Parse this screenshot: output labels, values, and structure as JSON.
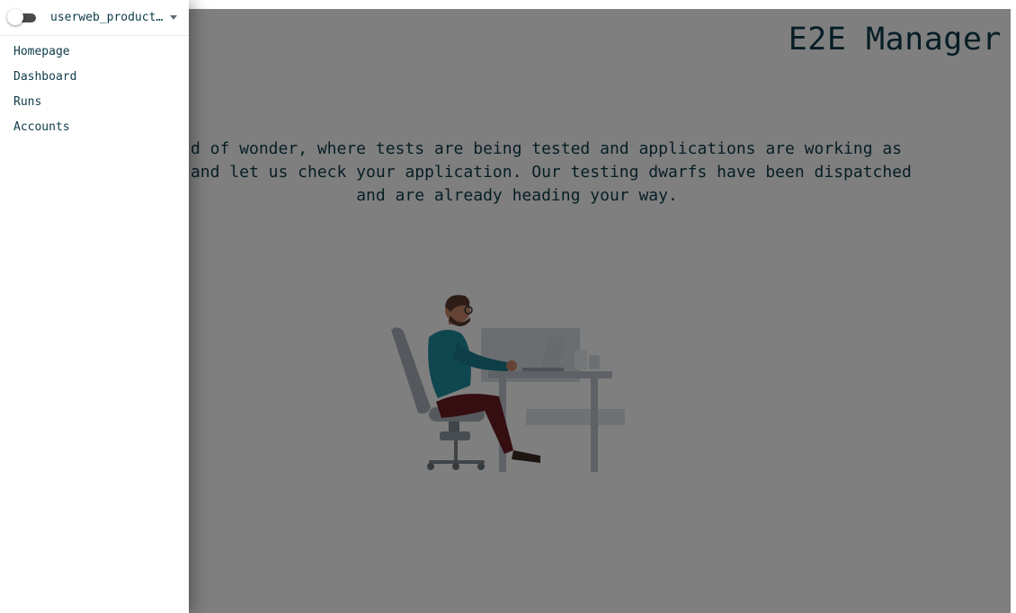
{
  "app": {
    "title": "E2E Manager"
  },
  "main": {
    "intro_lines": [
      "e world of wonder, where tests are being tested and applications are working as",
      "e rest and let us check your application. Our testing dwarfs have been dispatched",
      "and are already heading your way."
    ],
    "illustration_icon": "person-at-desk-illustration"
  },
  "drawer": {
    "project_select_value": "userweb_product…",
    "toggle_on": false,
    "nav_items": [
      {
        "label": "Homepage"
      },
      {
        "label": "Dashboard"
      },
      {
        "label": "Runs"
      },
      {
        "label": "Accounts"
      }
    ]
  },
  "colors": {
    "text": "#0d3b4a",
    "overlay": "rgba(0,0,0,0.5)",
    "drawer_bg": "#ffffff"
  }
}
